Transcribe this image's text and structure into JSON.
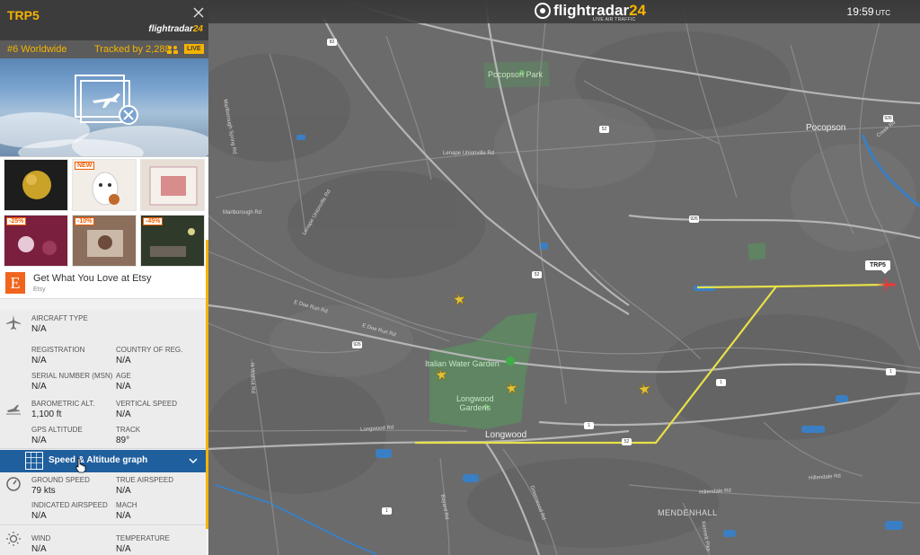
{
  "app": {
    "brand_prefix": "flightradar",
    "brand_number": "24",
    "tagline": "LIVE AIR TRAFFIC"
  },
  "clock": {
    "time": "19:59",
    "zone": "UTC"
  },
  "panel": {
    "callsign": "TRP5",
    "brand_prefix": "flightradar",
    "brand_number": "24",
    "rank": "#6 Worldwide",
    "tracked": "Tracked by 2,288",
    "live": "LIVE",
    "ads": [
      {
        "tag": "",
        "color": "#1d1d1d"
      },
      {
        "tag": "NEW",
        "color": "#f2ede7"
      },
      {
        "tag": "",
        "color": "#e7dfd6"
      },
      {
        "tag": "-25%",
        "color": "#7a1f3d"
      },
      {
        "tag": "-10%",
        "color": "#8b6e5c"
      },
      {
        "tag": "-45%",
        "color": "#2f3a2a"
      }
    ],
    "etsy": {
      "title": "Get What You Love at Etsy",
      "source": "Etsy",
      "logo": "E"
    },
    "fields": {
      "aircraft_type_label": "AIRCRAFT TYPE",
      "aircraft_type": "N/A",
      "registration_label": "REGISTRATION",
      "registration": "N/A",
      "country_label": "COUNTRY OF REG.",
      "country": "N/A",
      "serial_label": "SERIAL NUMBER (MSN)",
      "serial": "N/A",
      "age_label": "AGE",
      "age": "N/A",
      "baro_label": "BAROMETRIC ALT.",
      "baro": "1,100 ft",
      "vspeed_label": "VERTICAL SPEED",
      "vspeed": "N/A",
      "gps_label": "GPS ALTITUDE",
      "gps": "N/A",
      "track_label": "TRACK",
      "track": "89°",
      "graph_bar": "Speed & Altitude graph",
      "ground_speed_label": "GROUND SPEED",
      "ground_speed": "79 kts",
      "tas_label": "TRUE AIRSPEED",
      "tas": "N/A",
      "ias_label": "INDICATED AIRSPEED",
      "ias": "N/A",
      "mach_label": "MACH",
      "mach": "N/A",
      "wind_label": "WIND",
      "wind": "N/A",
      "temp_label": "TEMPERATURE",
      "temp": "N/A"
    }
  },
  "map": {
    "labels": {
      "pocopson_park": "Pocopson Park",
      "pocopson": "Pocopson",
      "lenape_unionville": "Lenape Unionville Rd",
      "marlborough_spring": "Marlborough Spring Rd",
      "marlborough": "Marlborough Rd",
      "lenape_unionville2": "Lenape Unionville Rd",
      "e_doe_run": "E Doe Run Rd",
      "e_doe_run2": "E Doe Run Rd",
      "creek_rd": "Creek Rd",
      "n_walnut": "N Walnut Rd",
      "italian_water_garden": "Italian Water Garden",
      "longwood_gardens": "Longwood\nGardens",
      "longwood_rd": "Longwood Rd",
      "longwood": "Longwood",
      "mendenhall": "MENDENHALL",
      "hillendale": "Hillendale Rd",
      "hillendale2": "Hillendale Rd",
      "kennett_pike": "Kennett Pike",
      "greenwood": "Greenwood Rd",
      "bayard": "Bayard Rd"
    },
    "shields": [
      "82",
      "52",
      "926",
      "52",
      "926",
      "1",
      "1",
      "52",
      "1",
      "926",
      "1"
    ],
    "aircraft_label": "TRP5",
    "track_color": "#e8e04a",
    "aircraft_color": "#e83a3a"
  }
}
